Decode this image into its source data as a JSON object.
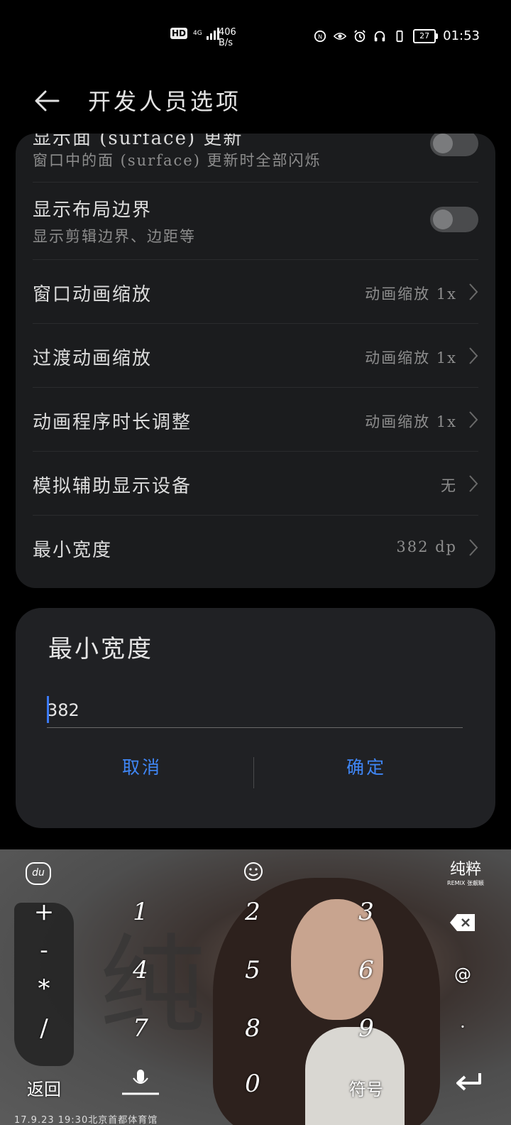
{
  "status_bar": {
    "network_type": "4G",
    "hd_label": "HD",
    "net_speed_value": "406",
    "net_speed_unit": "B/s",
    "battery": "27",
    "time": "01:53",
    "icons": [
      "nfc-icon",
      "eye-icon",
      "alarm-icon",
      "headphones-icon",
      "vibrate-icon"
    ]
  },
  "app_bar": {
    "title": "开发人员选项"
  },
  "settings": {
    "partial_row": {
      "label": "显示面 (surface) 更新",
      "subtitle": "窗口中的面 (surface) 更新时全部闪烁",
      "enabled": false
    },
    "layout_bounds": {
      "label": "显示布局边界",
      "subtitle": "显示剪辑边界、边距等",
      "enabled": false
    },
    "window_anim": {
      "label": "窗口动画缩放",
      "value": "动画缩放 1x"
    },
    "transition_anim": {
      "label": "过渡动画缩放",
      "value": "动画缩放 1x"
    },
    "animator_duration": {
      "label": "动画程序时长调整",
      "value": "动画缩放 1x"
    },
    "secondary_display": {
      "label": "模拟辅助显示设备",
      "value": "无"
    },
    "min_width": {
      "label": "最小宽度",
      "value": "382 dp"
    }
  },
  "dialog": {
    "title": "最小宽度",
    "input_value": "382",
    "cancel_label": "取消",
    "confirm_label": "确定"
  },
  "keyboard": {
    "symbols_left": [
      "+",
      "-",
      "*",
      "/"
    ],
    "row1": [
      "1",
      "2",
      "3"
    ],
    "row2": [
      "4",
      "5",
      "6"
    ],
    "row3": [
      "7",
      "8",
      "9"
    ],
    "zero": "0",
    "back_label": "返回",
    "symbol_label": "符号",
    "at_key": "@",
    "dot_key": "·",
    "logo_text": "du",
    "brand_text": "纯粹",
    "brand_sub": "REMIX 张靓颖",
    "footer_text": "17.9.23 19:30北京首都体育馆"
  }
}
